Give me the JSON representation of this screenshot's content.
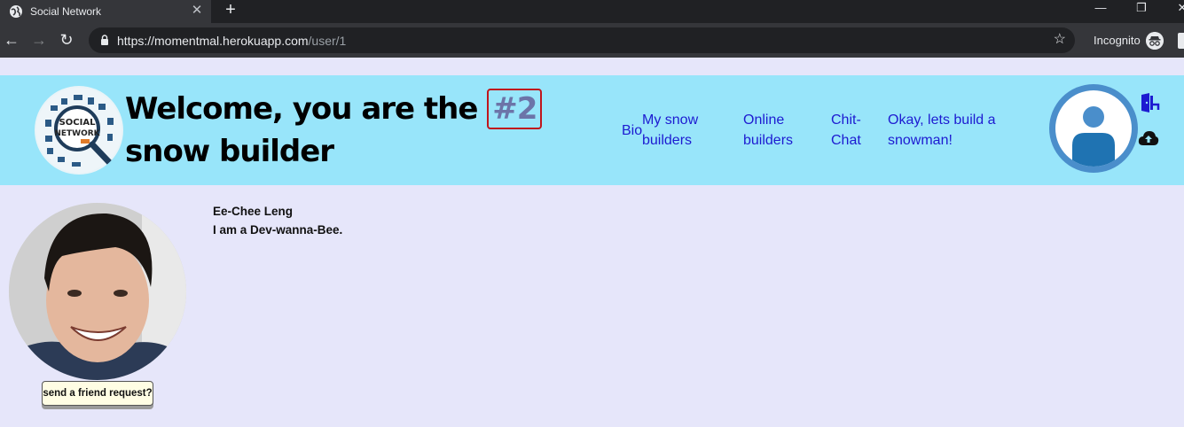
{
  "browser": {
    "tab_title": "Social Network",
    "tab_close": "✕",
    "new_tab": "+",
    "url_host": "https://momentmal.herokuapp.com",
    "url_path": "/user/1",
    "incognito_label": "Incognito"
  },
  "header": {
    "headline_pre": "Welcome, you are the ",
    "rank": "#2",
    "headline_post": " snow builder",
    "logo_text_top": "SOCIAL",
    "logo_text_bottom": "NETWORK",
    "nav": [
      {
        "label": "Bio"
      },
      {
        "label": "My snow builders"
      },
      {
        "label": "Online builders"
      },
      {
        "label": "Chit-Chat"
      },
      {
        "label": "Okay, lets build a snowman!"
      }
    ],
    "icons": [
      "logout-icon",
      "cloud-upload-icon"
    ]
  },
  "profile": {
    "name": "Ee-Chee Leng",
    "bio": "I am a Dev-wanna-Bee.",
    "friend_button": "send a friend request?"
  },
  "colors": {
    "page_bg": "#e6e6fa",
    "header_bg": "#98e5fa",
    "nav_link": "#1d1bd1",
    "rank_border": "#c0151b",
    "rank_text": "#6c74a8",
    "avatar_ring": "#4a8ecb"
  }
}
